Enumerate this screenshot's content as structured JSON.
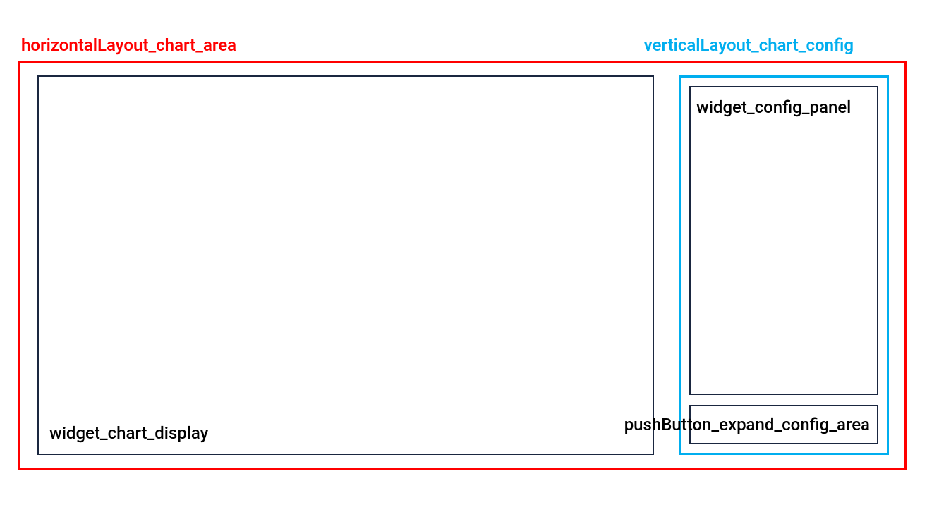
{
  "layout": {
    "horizontal_label": "horizontalLayout_chart_area",
    "vertical_label": "verticalLayout_chart_config",
    "chart_display_label": "widget_chart_display",
    "config_panel_label": "widget_config_panel",
    "expand_button_label": "pushButton_expand_config_area"
  }
}
